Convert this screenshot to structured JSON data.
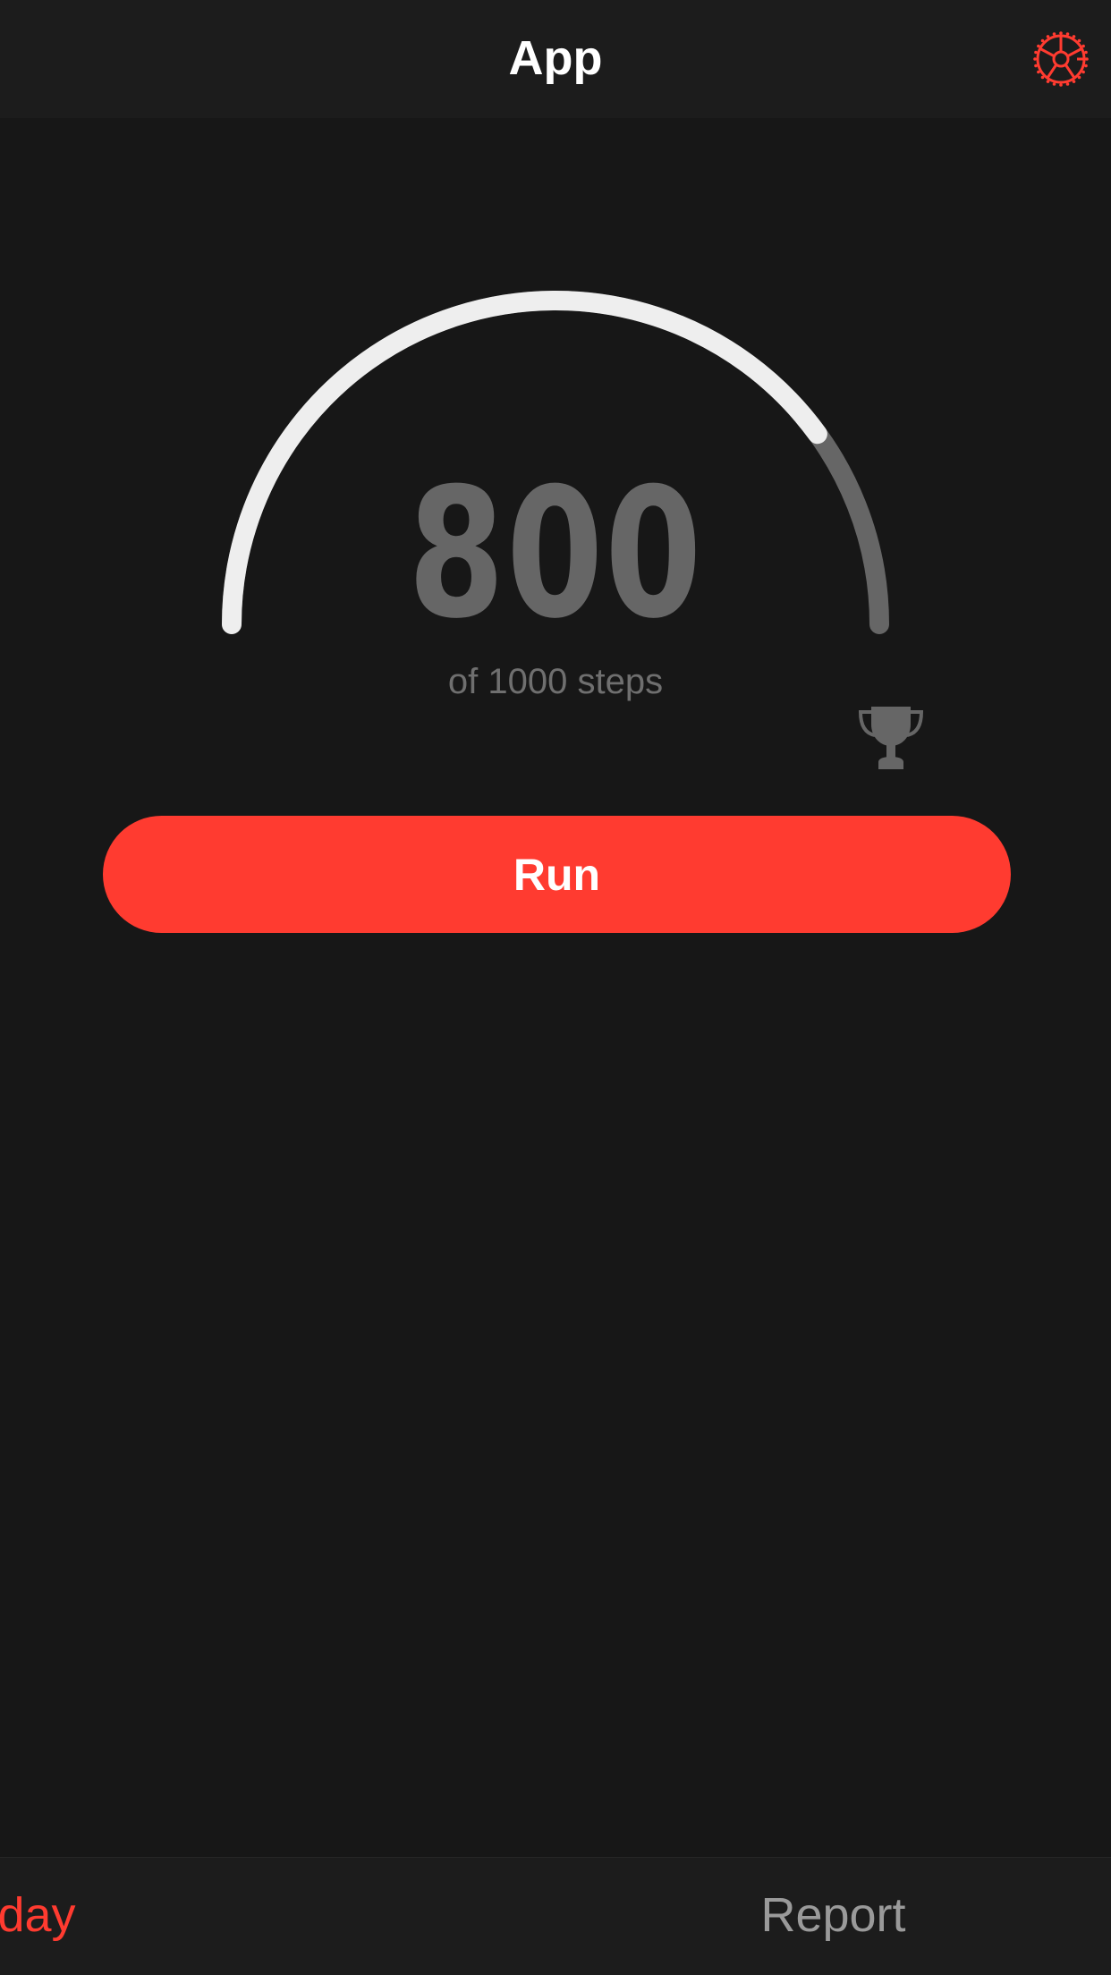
{
  "app": {
    "title": "App"
  },
  "header": {
    "settings_icon": "gear-icon"
  },
  "steps": {
    "current": 800,
    "current_label": "800",
    "goal_label": "of 1000 steps",
    "progress_fraction": 0.8,
    "goal_icon": "trophy-icon"
  },
  "actions": {
    "run_label": "Run"
  },
  "tabs": [
    {
      "label": "Today",
      "active": true
    },
    {
      "label": "Report",
      "active": false
    }
  ],
  "colors": {
    "accent": "#ff3b30",
    "background": "#171717",
    "bar": "#1c1c1c",
    "progress_fill": "#eeeeee",
    "progress_track": "#666666",
    "muted_text": "#6f6f6f",
    "inactive_tab": "#9a9a9a"
  }
}
